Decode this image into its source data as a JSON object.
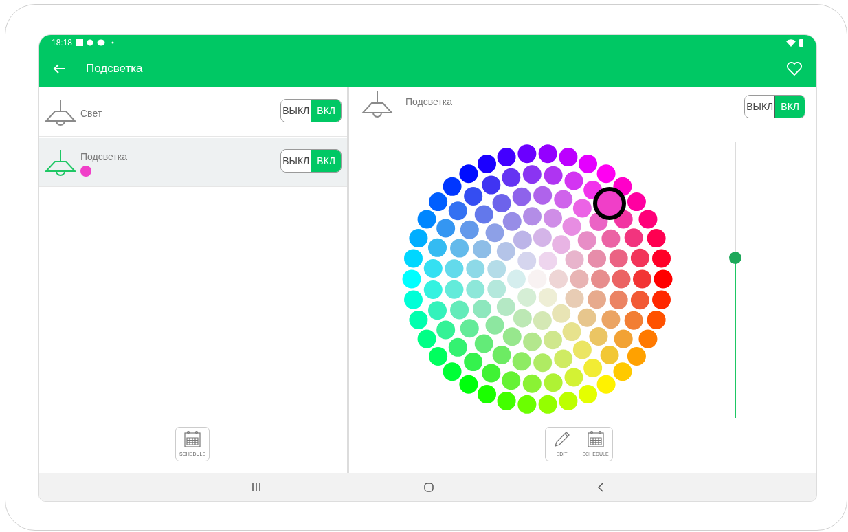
{
  "status_bar": {
    "time": "18:18"
  },
  "app_bar": {
    "title": "Подсветка"
  },
  "devices": [
    {
      "name": "Свет",
      "selected": false,
      "toggle": {
        "off_label": "ВЫКЛ",
        "on_label": "ВКЛ",
        "on": true
      }
    },
    {
      "name": "Подсветка",
      "selected": true,
      "color": "#f03fc8",
      "toggle": {
        "off_label": "ВЫКЛ",
        "on_label": "ВКЛ",
        "on": true
      }
    }
  ],
  "left_actions": [
    {
      "kind": "schedule",
      "label": "SCHEDULE"
    }
  ],
  "detail": {
    "name": "Подсветка",
    "toggle": {
      "off_label": "ВЫКЛ",
      "on_label": "ВКЛ",
      "on": true
    },
    "color": "#f03fc8",
    "brightness": {
      "level": 0.58
    }
  },
  "right_actions": [
    {
      "kind": "edit",
      "label": "EDIT"
    },
    {
      "kind": "schedule",
      "label": "SCHEDULE"
    }
  ]
}
